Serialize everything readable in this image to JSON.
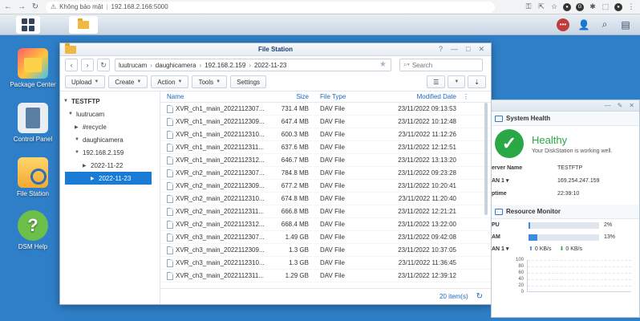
{
  "browser": {
    "security_label": "Không bảo mật",
    "url": "192.168.2.166:5000"
  },
  "desktop": {
    "icons": [
      {
        "label": "Package Center"
      },
      {
        "label": "Control Panel"
      },
      {
        "label": "File Station"
      },
      {
        "label": "DSM Help"
      }
    ]
  },
  "file_station": {
    "title": "File Station",
    "breadcrumb": [
      "luutrucam",
      "daughicamera",
      "192.168.2.159",
      "2022-11-23"
    ],
    "search_placeholder": "Search",
    "toolbar": [
      "Upload",
      "Create",
      "Action",
      "Tools",
      "Settings"
    ],
    "tree": [
      {
        "label": "TESTFTP",
        "level": 0,
        "arrow": "▼"
      },
      {
        "label": "luutrucam",
        "level": 1,
        "arrow": "▼"
      },
      {
        "label": "#recycle",
        "level": 2,
        "arrow": "▶"
      },
      {
        "label": "daughicamera",
        "level": 2,
        "arrow": "▼"
      },
      {
        "label": "192.168.2.159",
        "level": 3,
        "arrow": "▼"
      },
      {
        "label": "2022-11-22",
        "level": 4,
        "arrow": "▶"
      },
      {
        "label": "2022-11-23",
        "level": 4,
        "arrow": "▶"
      }
    ],
    "columns": {
      "name": "Name",
      "size": "Size",
      "type": "File Type",
      "date": "Modified Date"
    },
    "files": [
      {
        "name": "XVR_ch1_main_2022112307...",
        "size": "731.4 MB",
        "type": "DAV File",
        "date": "23/11/2022 09:13:53"
      },
      {
        "name": "XVR_ch1_main_2022112309...",
        "size": "647.4 MB",
        "type": "DAV File",
        "date": "23/11/2022 10:12:48"
      },
      {
        "name": "XVR_ch1_main_2022112310...",
        "size": "600.3 MB",
        "type": "DAV File",
        "date": "23/11/2022 11:12:26"
      },
      {
        "name": "XVR_ch1_main_2022112311...",
        "size": "637.6 MB",
        "type": "DAV File",
        "date": "23/11/2022 12:12:51"
      },
      {
        "name": "XVR_ch1_main_2022112312...",
        "size": "646.7 MB",
        "type": "DAV File",
        "date": "23/11/2022 13:13:20"
      },
      {
        "name": "XVR_ch2_main_2022112307...",
        "size": "784.8 MB",
        "type": "DAV File",
        "date": "23/11/2022 09:23:28"
      },
      {
        "name": "XVR_ch2_main_2022112309...",
        "size": "677.2 MB",
        "type": "DAV File",
        "date": "23/11/2022 10:20:41"
      },
      {
        "name": "XVR_ch2_main_2022112310...",
        "size": "674.8 MB",
        "type": "DAV File",
        "date": "23/11/2022 11:20:40"
      },
      {
        "name": "XVR_ch2_main_2022112311...",
        "size": "666.8 MB",
        "type": "DAV File",
        "date": "23/11/2022 12:21:21"
      },
      {
        "name": "XVR_ch2_main_2022112312...",
        "size": "668.4 MB",
        "type": "DAV File",
        "date": "23/11/2022 13:22:00"
      },
      {
        "name": "XVR_ch3_main_2022112307...",
        "size": "1.49 GB",
        "type": "DAV File",
        "date": "23/11/2022 09:42:08"
      },
      {
        "name": "XVR_ch3_main_2022112309...",
        "size": "1.3 GB",
        "type": "DAV File",
        "date": "23/11/2022 10:37:05"
      },
      {
        "name": "XVR_ch3_main_2022112310...",
        "size": "1.3 GB",
        "type": "DAV File",
        "date": "23/11/2022 11:36:45"
      },
      {
        "name": "XVR_ch3_main_2022112311...",
        "size": "1.29 GB",
        "type": "DAV File",
        "date": "23/11/2022 12:39:12"
      }
    ],
    "item_count": "20 item(s)"
  },
  "system_health": {
    "title": "System Health",
    "status": "Healthy",
    "message": "Your DiskStation is working well.",
    "server_name_label": "erver Name",
    "server_name": "TESTFTP",
    "lan_label": "AN 1 ▾",
    "lan_ip": "169.254.247.159",
    "uptime_label": "ptime",
    "uptime": "22:39:10"
  },
  "resource_monitor": {
    "title": "Resource Monitor",
    "cpu_label": "PU",
    "cpu_percent": 2,
    "cpu_text": "2%",
    "ram_label": "AM",
    "ram_percent": 13,
    "ram_text": "13%",
    "lan_label": "AN 1 ▾",
    "upload": "0 KB/s",
    "download": "0 KB/s",
    "y_ticks": [
      "100",
      "80",
      "60",
      "40",
      "20",
      "0"
    ]
  }
}
